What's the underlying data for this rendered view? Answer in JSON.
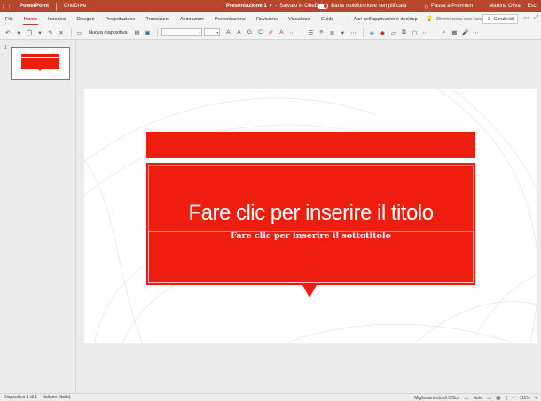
{
  "titlebar": {
    "app": "PowerPoint",
    "storage": "OneDrive",
    "document": "Presentazione 1",
    "dash": "-",
    "saved": "Salvato in OneDrive",
    "ribbon_toggle_label": "Barra multifunzione semplificata",
    "premium": "Passa a Premium",
    "user": "Martina Oliva",
    "exit": "Esci"
  },
  "tabs": [
    "File",
    "Home",
    "Inserisci",
    "Disegno",
    "Progettazione",
    "Transizioni",
    "Animazioni",
    "Presentazione",
    "Revisione",
    "Visualizza",
    "Guida"
  ],
  "active_tab": "Home",
  "open_desktop": "Apri nell'applicazione desktop",
  "tell_me": "Dimmi cosa vuoi fare",
  "share": "Condividi",
  "toolbar": {
    "new_slide": "Nuova diapositiva",
    "font_name": "",
    "font_size": ""
  },
  "thumbnail": {
    "number": "1"
  },
  "slide": {
    "title_placeholder": "Fare clic per inserire il titolo",
    "subtitle_placeholder": "Fare clic per inserire il sottotitolo",
    "accent_color": "#ee1d0f"
  },
  "status": {
    "slide_counter": "Diapositiva 1 di 1",
    "language": "Italiano (Italia)",
    "improve": "Miglioramento di Office",
    "notes": "Note",
    "zoom": "111%"
  },
  "colors": {
    "brand": "#b7472a",
    "accent": "#ee1d0f"
  }
}
